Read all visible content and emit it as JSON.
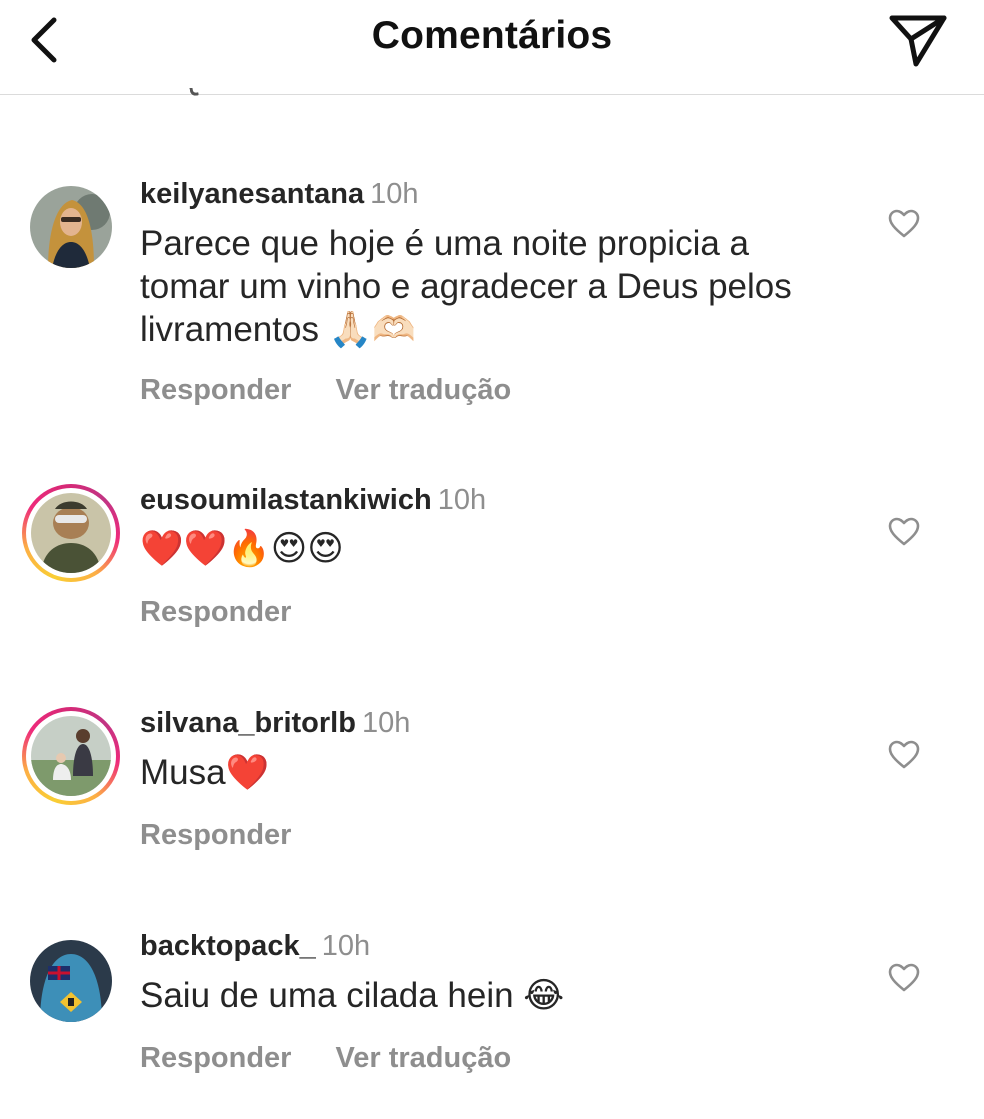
{
  "header": {
    "title": "Comentários",
    "back_icon": "chevron-left-icon",
    "send_icon": "paper-plane-icon"
  },
  "colors": {
    "text": "#262626",
    "secondary": "#8e8e8e",
    "divider": "#dbdbdb",
    "story_ring": [
      "#f9ce34",
      "#ee2a7b",
      "#c13584"
    ]
  },
  "comments": [
    {
      "username": "keilyanesantana",
      "time": "10h",
      "text": "Parece que hoje é uma noite propicia a tomar um vinho e agradecer a Deus pelos livramentos 🙏🏻🫶🏻",
      "reply": "Responder",
      "translate": "Ver tradução",
      "story_ring": false
    },
    {
      "username": "eusoumilastankiwich",
      "time": "10h",
      "text": "❤️❤️🔥😍😍",
      "reply": "Responder",
      "story_ring": true
    },
    {
      "username": "silvana_britorlb",
      "time": "10h",
      "text": "Musa❤️",
      "reply": "Responder",
      "story_ring": true
    },
    {
      "username": "backtopack_",
      "time": "10h",
      "text": "Saiu de uma cilada hein 😂",
      "reply": "Responder",
      "translate": "Ver tradução",
      "story_ring": false
    }
  ]
}
